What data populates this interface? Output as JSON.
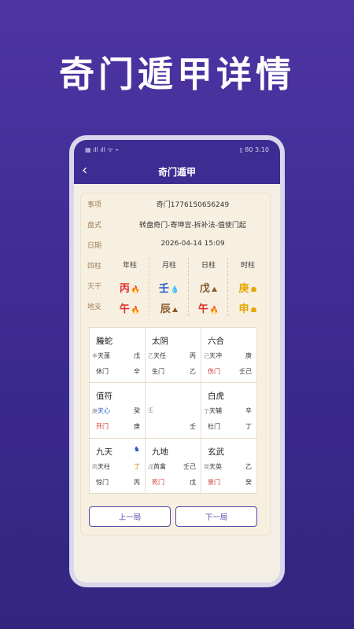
{
  "promo_title": "奇门遁甲详情",
  "status": {
    "left_icons": "▦ ıll ıll ᯤ ⌁",
    "right": "▯ 80 3:10"
  },
  "nav": {
    "back": "‹",
    "title": "奇门遁甲"
  },
  "info": {
    "item_label": "事项",
    "item_value": "奇门1776150656249",
    "plate_label": "盘式",
    "plate_value": "转盘奇门-寄坤宫-拆补法-值使门起",
    "date_label": "日期",
    "date_value": "2026-04-14 15:09"
  },
  "pillars": {
    "header_label": "四柱",
    "headers": [
      "年柱",
      "月柱",
      "日柱",
      "时柱"
    ],
    "stem_label": "天干",
    "branch_label": "地支",
    "stems": [
      {
        "char": "丙",
        "color": "#e0302a",
        "icon": "🔥",
        "icon_name": "fire-icon"
      },
      {
        "char": "壬",
        "color": "#1f57c4",
        "icon": "💧",
        "icon_name": "water-icon"
      },
      {
        "char": "戊",
        "color": "#8a5a2b",
        "icon": "⛰",
        "icon_name": "earth-icon"
      },
      {
        "char": "庚",
        "color": "#e6a600",
        "icon": "☗",
        "icon_name": "metal-icon"
      }
    ],
    "branches": [
      {
        "char": "午",
        "color": "#e0302a",
        "icon": "🔥",
        "icon_name": "fire-icon"
      },
      {
        "char": "辰",
        "color": "#8a5a2b",
        "icon": "⛰",
        "icon_name": "earth-icon"
      },
      {
        "char": "午",
        "color": "#e0302a",
        "icon": "🔥",
        "icon_name": "fire-icon"
      },
      {
        "char": "申",
        "color": "#e6a600",
        "icon": "☗",
        "icon_name": "metal-icon"
      }
    ]
  },
  "palaces": [
    {
      "god": "螣蛇",
      "l1_small": "辛",
      "l1_main": "天蓬",
      "l1_color": "#333333",
      "r1": "戊",
      "r1_color": "#333333",
      "l2": "休门",
      "l2_color": "#333333",
      "r2": "辛",
      "r2_color": "#333333"
    },
    {
      "god": "太阴",
      "l1_small": "乙",
      "l1_main": "天任",
      "l1_color": "#333333",
      "r1": "丙",
      "r1_color": "#333333",
      "l2": "生门",
      "l2_color": "#333333",
      "r2": "乙",
      "r2_color": "#333333"
    },
    {
      "god": "六合",
      "l1_small": "己",
      "l1_main": "天冲",
      "l1_color": "#333333",
      "r1": "庚",
      "r1_color": "#333333",
      "l2": "伤门",
      "l2_color": "#d0302a",
      "r2": "壬己",
      "r2_color": "#333333"
    },
    {
      "god": "值符",
      "l1_small": "庚",
      "l1_main": "天心",
      "l1_color": "#1f57c4",
      "r1": "癸",
      "r1_color": "#333333",
      "l2": "开门",
      "l2_color": "#d0302a",
      "r2": "庚",
      "r2_color": "#333333"
    },
    {
      "center": true,
      "l1_small": "壬",
      "r2": "壬",
      "r2_color": "#333333"
    },
    {
      "god": "白虎",
      "l1_small": "丁",
      "l1_main": "天辅",
      "l1_color": "#333333",
      "r1": "辛",
      "r1_color": "#333333",
      "l2": "杜门",
      "l2_color": "#333333",
      "r2": "丁",
      "r2_color": "#333333"
    },
    {
      "god": "九天",
      "horse": true,
      "l1_small": "丙",
      "l1_main": "天柱",
      "l1_color": "#333333",
      "r1": "丁",
      "r1_color": "#d08a00",
      "l2": "惊门",
      "l2_color": "#333333",
      "r2": "丙",
      "r2_color": "#333333"
    },
    {
      "god": "九地",
      "l1_small": "戊",
      "l1_main": "芮禽",
      "l1_color": "#333333",
      "r1": "壬己",
      "r1_color": "#333333",
      "l2": "死门",
      "l2_color": "#d0302a",
      "r2": "戊",
      "r2_color": "#333333"
    },
    {
      "god": "玄武",
      "l1_small": "癸",
      "l1_main": "天英",
      "l1_color": "#333333",
      "r1": "乙",
      "r1_color": "#333333",
      "l2": "景门",
      "l2_color": "#d0302a",
      "r2": "癸",
      "r2_color": "#333333"
    }
  ],
  "buttons": {
    "prev": "上一局",
    "next": "下一局"
  }
}
